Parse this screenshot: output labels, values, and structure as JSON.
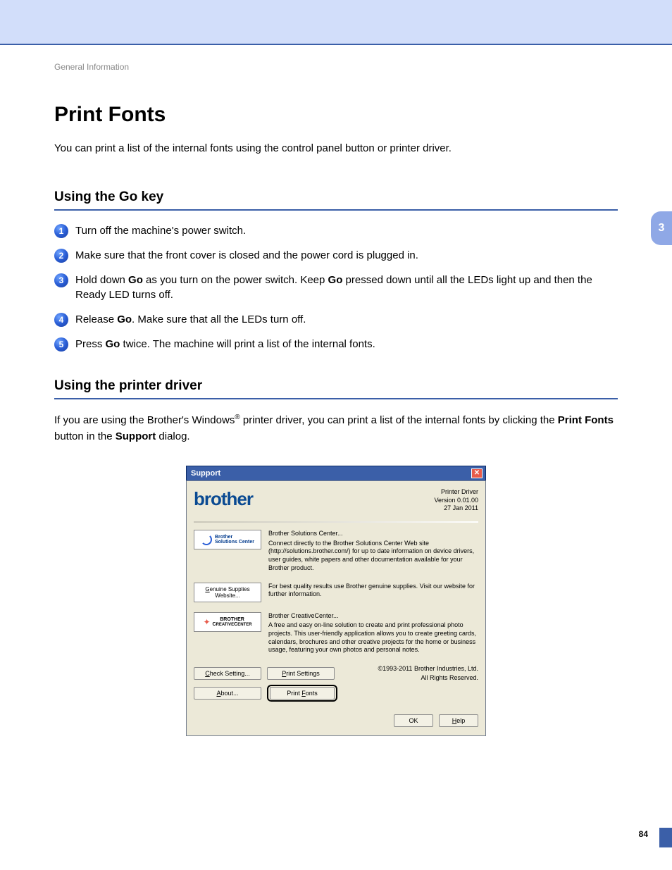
{
  "breadcrumb": "General Information",
  "title": "Print Fonts",
  "intro": "You can print a list of the internal fonts using the control panel button or printer driver.",
  "section1_heading": "Using the Go key",
  "steps": [
    "Turn off the machine's power switch.",
    "Make sure that the front cover is closed and the power cord is plugged in.",
    "Hold down Go as you turn on the power switch. Keep Go pressed down until all the LEDs light up and then the Ready LED turns off.",
    "Release Go. Make sure that all the LEDs turn off.",
    "Press Go twice. The machine will print a list of the internal fonts."
  ],
  "section2_heading": "Using the printer driver",
  "para2_pre": "If you are using the Brother's Windows",
  "para2_post": " printer driver, you can print a list of the internal fonts by clicking the ",
  "para2_bold1": "Print Fonts",
  "para2_mid": " button in the ",
  "para2_bold2": "Support",
  "para2_end": " dialog.",
  "side_tab": "3",
  "page_number": "84",
  "dialog": {
    "title": "Support",
    "head_right": {
      "line1": "Printer Driver",
      "line2": "Version 0.01.00",
      "line3": "27 Jan 2011"
    },
    "logo_text": "brother",
    "solutions": {
      "btn_line1": "Brother",
      "btn_line2": "Solutions Center",
      "title": "Brother Solutions Center...",
      "desc": "Connect directly to the Brother Solutions Center Web site (http://solutions.brother.com/) for up to date information on device drivers, user guides, white papers and other documentation available for your Brother product."
    },
    "supplies": {
      "btn": "Genuine Supplies Website...",
      "desc": "For best quality results use Brother genuine supplies. Visit our website for further information."
    },
    "creative": {
      "btn_line1": "BROTHER",
      "btn_line2": "CREATIVECENTER",
      "title": "Brother CreativeCenter...",
      "desc": "A free and easy on-line solution to create and print professional photo projects. This user-friendly application allows you to create greeting cards, calendars, brochures and other creative projects for the home or business usage, featuring your own photos and personal notes."
    },
    "buttons": {
      "check_setting": "Check Setting...",
      "about": "About...",
      "print_settings": "Print Settings",
      "print_fonts": "Print Fonts",
      "ok": "OK",
      "help": "Help"
    },
    "copyright1": "©1993-2011 Brother Industries, Ltd.",
    "copyright2": "All Rights Reserved."
  }
}
